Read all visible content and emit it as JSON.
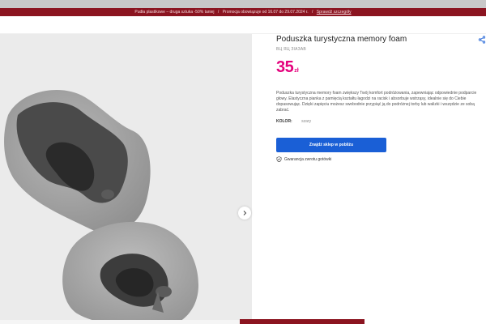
{
  "promo": {
    "part1": "Pudła plastikowe – druga sztuka -50% taniej",
    "part2": "Promocja obowiązuje od 16.07 do 29.07.2024 r.",
    "link": "Sprawdź szczegóły",
    "color": "#8b1420"
  },
  "product": {
    "title": "Poduszka turystyczna memory foam",
    "sku": "ВЦ ЯЦ ЗІАЗАВ",
    "price_amount": "35",
    "price_currency": "zł",
    "price_color": "#e4007c",
    "description": "Poduszka turystyczna memory foam zwiększy Twój komfort podróżowania, zapewniając odpowiednie podparcie głowy. Elastyczna pianka z pamięcią kształtu łagodzi na racisk i absorbuje wstrząsy, idealnie się do Ciebie dopasowując. Dzięki zapięciu możesz swobodnie przypiąć ją do podróżnej torby lub walizki i wszędzie ze sobą zabrać.",
    "color_label": "KOLOR:",
    "color_value": "szary"
  },
  "actions": {
    "find_store": "Znajdź sklep w pobliżu",
    "button_color": "#1a5fd6",
    "guarantee": "Gwarancja zwrotu gotówki"
  },
  "gallery": {
    "next_icon": "chevron-right-icon"
  },
  "icons": {
    "share": "share-icon",
    "guarantee": "shield-check-icon"
  }
}
